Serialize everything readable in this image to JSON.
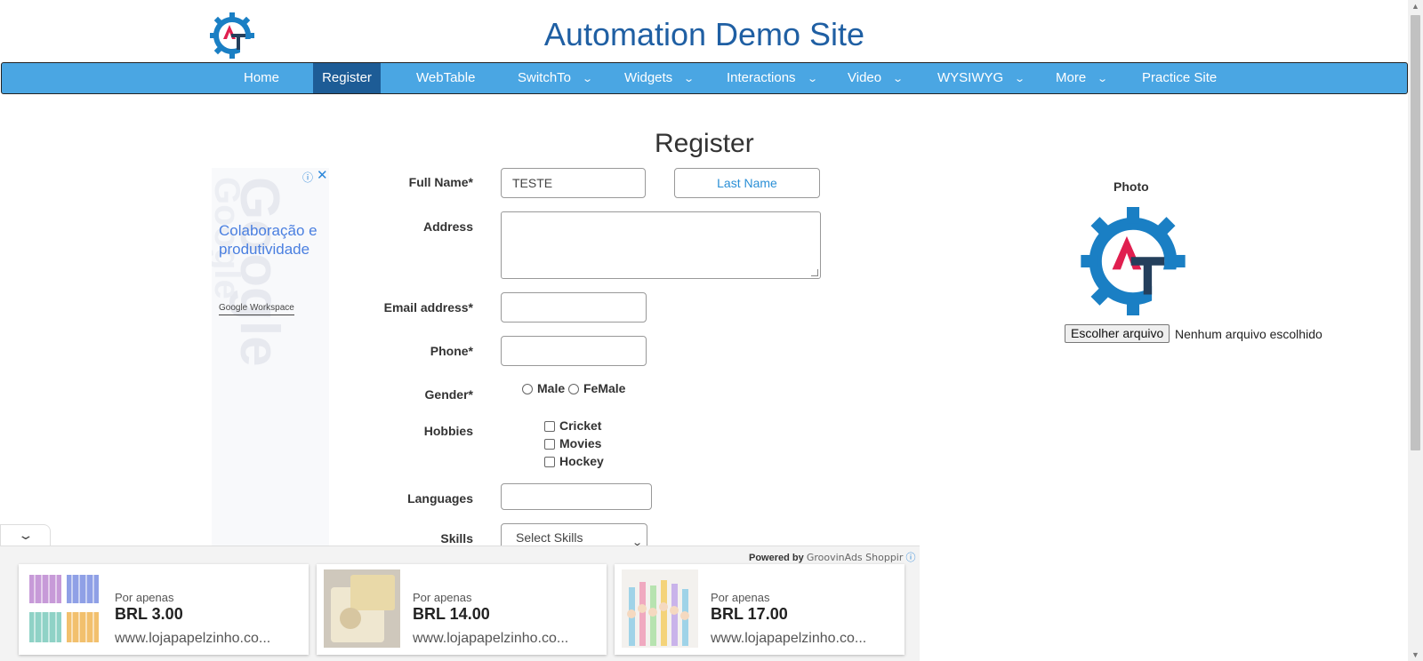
{
  "header": {
    "title": "Automation Demo Site"
  },
  "nav": {
    "items": [
      {
        "label": "Home"
      },
      {
        "label": "Register"
      },
      {
        "label": "WebTable"
      },
      {
        "label": "SwitchTo"
      },
      {
        "label": "Widgets"
      },
      {
        "label": "Interactions"
      },
      {
        "label": "Video"
      },
      {
        "label": "WYSIWYG"
      },
      {
        "label": "More"
      },
      {
        "label": "Practice Site"
      }
    ],
    "active": "Register",
    "colors": {
      "bar": "#4aa6e3",
      "active": "#1d5c96"
    }
  },
  "form": {
    "heading": "Register",
    "full_name_label": "Full Name*",
    "first_name_value": "TESTE",
    "last_name_placeholder": "Last Name",
    "address_label": "Address",
    "email_label": "Email address*",
    "phone_label": "Phone*",
    "gender_label": "Gender*",
    "gender_options": [
      "Male",
      "FeMale"
    ],
    "hobbies_label": "Hobbies",
    "hobbies": [
      "Cricket",
      "Movies",
      "Hockey"
    ],
    "languages_label": "Languages",
    "skills_label": "Skills",
    "skills_selected": "Select Skills"
  },
  "photo": {
    "label": "Photo",
    "button": "Escolher arquivo",
    "status": "Nenhum arquivo escolhido"
  },
  "left_ad": {
    "text": "Colaboração e produtividade",
    "brand": "Google Workspace"
  },
  "bottom_ad": {
    "powered_by": "Powered by",
    "provider": "GroovinAds Shoppir",
    "cards": [
      {
        "prefix": "Por apenas",
        "price": "BRL 3.00",
        "url": "www.lojapapelzinho.co..."
      },
      {
        "prefix": "Por apenas",
        "price": "BRL 14.00",
        "url": "www.lojapapelzinho.co..."
      },
      {
        "prefix": "Por apenas",
        "price": "BRL 17.00",
        "url": "www.lojapapelzinho.co..."
      }
    ]
  }
}
